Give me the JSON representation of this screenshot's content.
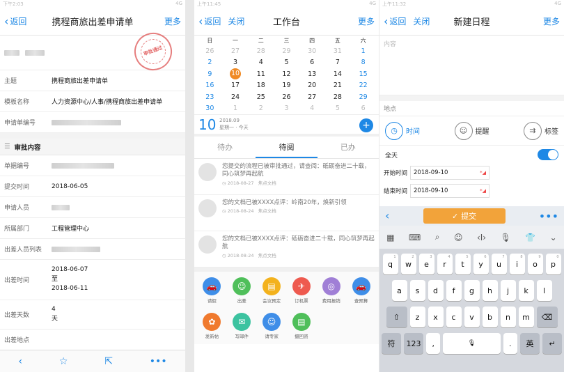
{
  "screen1": {
    "status_left": "下午2:03",
    "status_right": "4G",
    "nav": {
      "back": "返回",
      "title": "携程商旅出差申请单",
      "more": "更多"
    },
    "stamp": "审批通过",
    "fields": [
      {
        "label": "主题",
        "value": "携程商旅出差申请单"
      },
      {
        "label": "模板名称",
        "value": "人力资源中心/人事/携程商旅出差申请单"
      },
      {
        "label": "申请单编号",
        "value": ""
      }
    ],
    "section_title": "审批内容",
    "details": [
      {
        "label": "单据编号",
        "value": ""
      },
      {
        "label": "提交时间",
        "value": "2018-06-05"
      },
      {
        "label": "申请人员",
        "value": ""
      },
      {
        "label": "所属部门",
        "value": "工程管理中心"
      },
      {
        "label": "出差人员列表",
        "value": ""
      }
    ],
    "trip_time": {
      "label": "出差时间",
      "start": "2018-06-07",
      "to": "至",
      "end": "2018-06-11"
    },
    "trip_days": {
      "label": "出差天数",
      "num": "4",
      "unit": "天"
    },
    "trip_place": {
      "label": "出差地点"
    }
  },
  "screen2": {
    "status_left": "上午11:45",
    "status_right": "4G",
    "nav": {
      "back": "返回",
      "close": "关闭",
      "title": "工作台",
      "more": "更多"
    },
    "weekdays": [
      "日",
      "一",
      "二",
      "三",
      "四",
      "五",
      "六"
    ],
    "weeks": [
      [
        "26",
        "27",
        "28",
        "29",
        "30",
        "31",
        "1"
      ],
      [
        "2",
        "3",
        "4",
        "5",
        "6",
        "7",
        "8"
      ],
      [
        "9",
        "10",
        "11",
        "12",
        "13",
        "14",
        "15"
      ],
      [
        "16",
        "17",
        "18",
        "19",
        "20",
        "21",
        "22"
      ],
      [
        "23",
        "24",
        "25",
        "26",
        "27",
        "28",
        "29"
      ],
      [
        "30",
        "1",
        "2",
        "3",
        "4",
        "5",
        "6"
      ]
    ],
    "selected": {
      "day": "10",
      "month": "2018.09",
      "weekday": "星期一 · 今天"
    },
    "tabs": [
      "待办",
      "待阅",
      "已办"
    ],
    "messages": [
      {
        "text": "您提交的流程已被审批通过，请查阅：砥砺奋进二十载，同心筑梦再起航",
        "date": "2018-08-27",
        "tag": "焦点文档"
      },
      {
        "text": "您的文档已被XXXX点评：岭南20年，焕新引领",
        "date": "2018-08-24",
        "tag": "焦点文档"
      },
      {
        "text": "您的文档已被XXXX点评：砥砺奋进二十载，同心筑梦再起航",
        "date": "2018-08-24",
        "tag": "焦点文档"
      }
    ],
    "apps": [
      {
        "label": "请假",
        "color": "#3f8ee8",
        "icon": "car"
      },
      {
        "label": "出差",
        "color": "#4fbf5a",
        "icon": "person"
      },
      {
        "label": "会议预定",
        "color": "#f3b21d",
        "icon": "doc"
      },
      {
        "label": "订机票",
        "color": "#ee5a4f",
        "icon": "plane"
      },
      {
        "label": "费用报销",
        "color": "#a07fd6",
        "icon": "coin"
      },
      {
        "label": "查预算",
        "color": "#3f8ee8",
        "icon": "car"
      },
      {
        "label": "发新帖",
        "color": "#f07a2e",
        "icon": "flower"
      },
      {
        "label": "写邮件",
        "color": "#3cc3a0",
        "icon": "mail"
      },
      {
        "label": "请专家",
        "color": "#3f8ee8",
        "icon": "person"
      },
      {
        "label": "摄回资",
        "color": "#4fbf5a",
        "icon": "doc"
      }
    ]
  },
  "screen3": {
    "status_left": "上午11:32",
    "status_right": "4G",
    "nav": {
      "back": "返回",
      "close": "关闭",
      "title": "新建日程",
      "more": "更多"
    },
    "content_placeholder": "内容",
    "place_label": "地点",
    "options": [
      "时间",
      "提醒",
      "标签"
    ],
    "allday_label": "全天",
    "start_label": "开始时间",
    "start_value": "2018-09-10",
    "end_label": "结束时间",
    "end_value": "2018-09-10",
    "submit_label": "提交",
    "kb_row1": [
      "q",
      "w",
      "e",
      "r",
      "t",
      "y",
      "u",
      "i",
      "o",
      "p"
    ],
    "kb_row1_num": [
      "1",
      "2",
      "3",
      "4",
      "5",
      "6",
      "7",
      "8",
      "9",
      "0"
    ],
    "kb_row2": [
      "a",
      "s",
      "d",
      "f",
      "g",
      "h",
      "j",
      "k",
      "l"
    ],
    "kb_row3": [
      "z",
      "x",
      "c",
      "v",
      "b",
      "n",
      "m"
    ],
    "kb_sym": "符",
    "kb_123": "123",
    "kb_comma": ",",
    "kb_period": ".",
    "kb_lang": "英"
  }
}
